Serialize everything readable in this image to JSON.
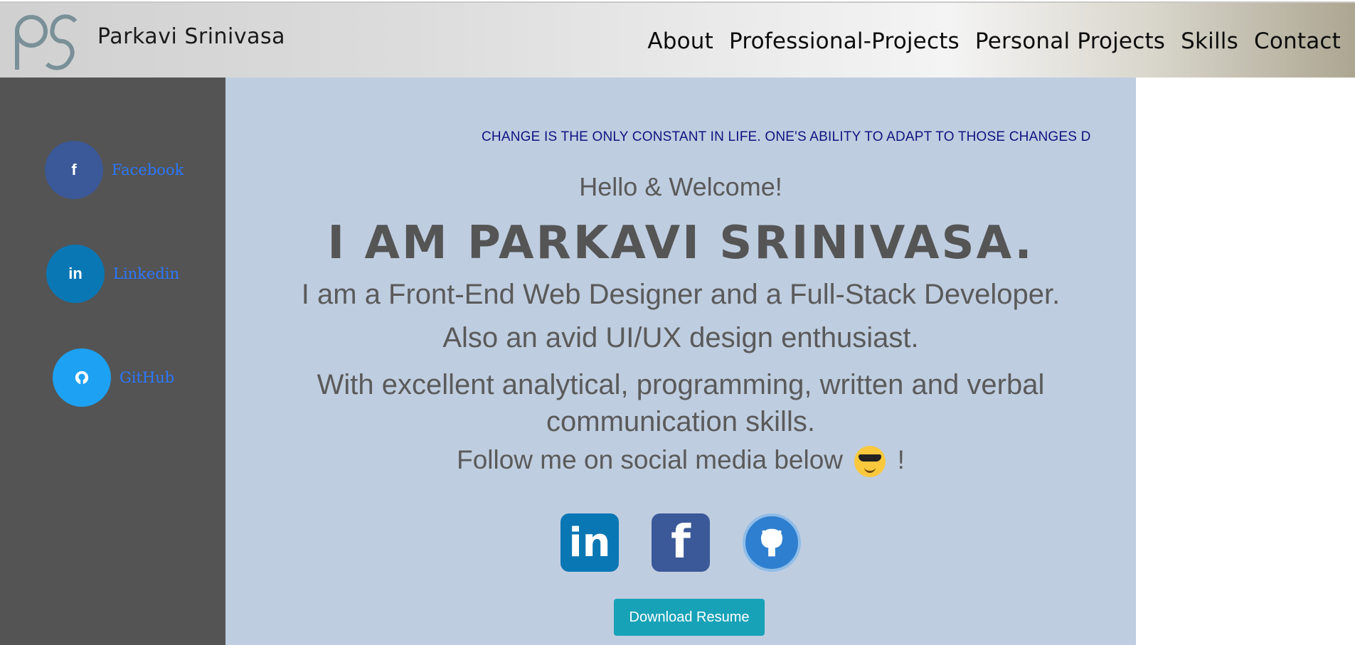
{
  "header": {
    "site_name": "Parkavi Srinivasa",
    "nav": [
      "About",
      "Professional-Projects",
      "Personal Projects",
      "Skills",
      "Contact"
    ]
  },
  "sidebar": {
    "items": [
      {
        "label": "Facebook",
        "icon": "f",
        "color": "#3b5998"
      },
      {
        "label": "Linkedin",
        "icon": "in",
        "color": "#0a77b5"
      },
      {
        "label": "GitHub",
        "icon": "github-icon",
        "color": "#1da1f2"
      }
    ]
  },
  "main": {
    "marquee": "CHANGE IS THE ONLY CONSTANT IN LIFE. ONE'S ABILITY TO ADAPT TO THOSE CHANGES D",
    "hello": "Hello & Welcome!",
    "headline": "I AM PARKAVI SRINIVASA.",
    "line1": "I am a Front-End Web Designer and a Full-Stack Developer.",
    "line2": "Also an avid UI/UX design enthusiast.",
    "line3": "With excellent analytical, programming, written and verbal communication skills.",
    "line4_before": "Follow me on social media below",
    "line4_after": "!",
    "linkedin_icon": "in",
    "facebook_icon": "f",
    "resume_button": "Download Resume"
  },
  "colors": {
    "sidebar_bg": "#545454",
    "main_bg": "#bfcde0",
    "marquee_text": "#0e1480",
    "button_bg": "#17a2b8",
    "sidebar_link": "#2b78ff"
  }
}
